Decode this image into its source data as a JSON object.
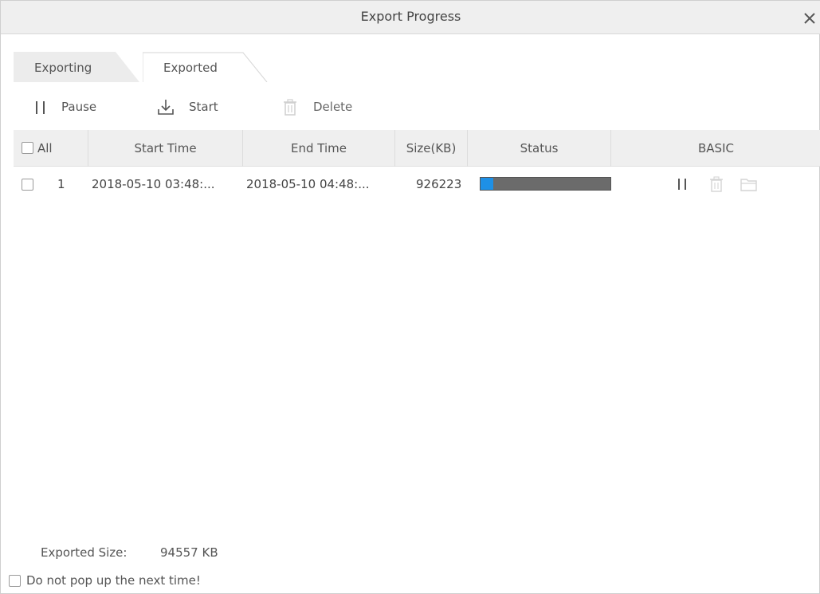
{
  "dialog": {
    "title": "Export Progress"
  },
  "tabs": [
    {
      "label": "Exporting",
      "active": false
    },
    {
      "label": "Exported",
      "active": true
    }
  ],
  "toolbar": {
    "pause_label": "Pause",
    "start_label": "Start",
    "delete_label": "Delete"
  },
  "table": {
    "columns": {
      "all": "All",
      "start_time": "Start Time",
      "end_time": "End Time",
      "size": "Size(KB)",
      "status": "Status",
      "basic": "BASIC"
    },
    "rows": [
      {
        "index": "1",
        "start_time": "2018-05-10 03:48:...",
        "end_time": "2018-05-10 04:48:...",
        "size": "926223",
        "progress_percent": 10
      }
    ]
  },
  "footer": {
    "exported_size_label": "Exported Size:",
    "exported_size_value": "94557 KB",
    "do_not_pop_label": "Do not pop up the next time!"
  },
  "colors": {
    "progress_fill": "#1e90e6",
    "progress_track": "#6b6b6b",
    "titlebar_bg": "#efefef"
  },
  "icons": {
    "close": "close-icon",
    "pause": "pause-icon",
    "start": "download-icon",
    "delete": "trash-icon",
    "folder": "folder-icon"
  }
}
